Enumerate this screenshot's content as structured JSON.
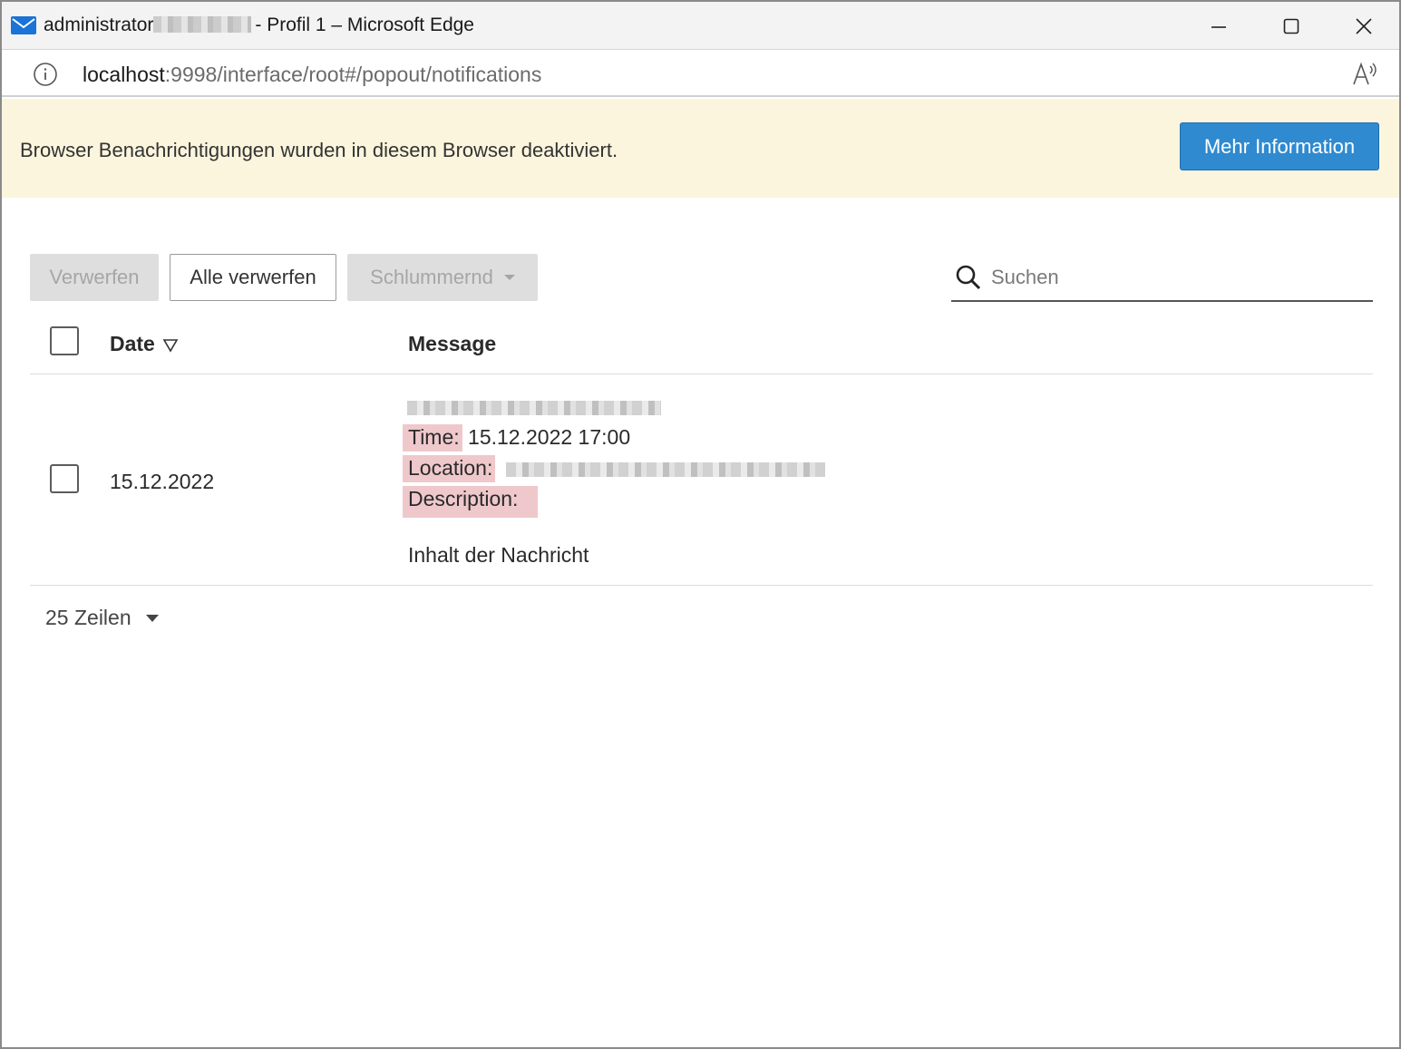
{
  "window": {
    "title_user": "administrator",
    "title_suffix": "- Profil 1 – Microsoft Edge"
  },
  "address": {
    "host": "localhost",
    "rest": ":9998/interface/root#/popout/notifications"
  },
  "banner": {
    "text": "Browser Benachrichtigungen wurden in diesem Browser deaktiviert.",
    "button_label": "Mehr Information"
  },
  "toolbar": {
    "dismiss_label": "Verwerfen",
    "dismiss_all_label": "Alle verwerfen",
    "snooze_label": "Schlummernd"
  },
  "search": {
    "placeholder": "Suchen"
  },
  "table": {
    "headers": {
      "date": "Date",
      "message": "Message"
    },
    "rows": [
      {
        "date": "15.12.2022",
        "time_label": "Time:",
        "time_value": "15.12.2022 17:00",
        "location_label": "Location:",
        "description_label": "Description:",
        "content": "Inhalt der Nachricht"
      }
    ]
  },
  "pagination": {
    "rows_label": "25 Zeilen"
  },
  "colors": {
    "banner_bg": "#fbf5dd",
    "primary": "#2f8ad0",
    "highlight": "#efc8cc"
  }
}
